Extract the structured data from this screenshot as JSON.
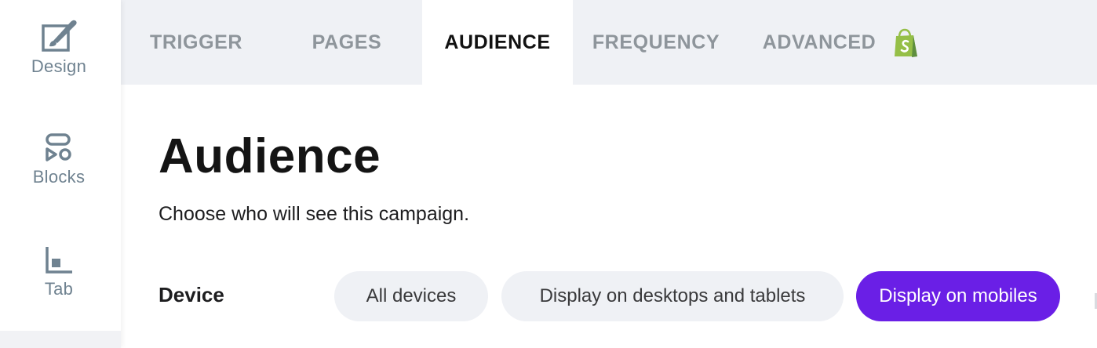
{
  "sidebar": {
    "items": [
      {
        "label": "Design",
        "icon": "design-brush-icon"
      },
      {
        "label": "Blocks",
        "icon": "blocks-icon"
      },
      {
        "label": "Tab",
        "icon": "tab-icon"
      }
    ]
  },
  "tabs": [
    {
      "label": "TRIGGER",
      "active": false
    },
    {
      "label": "PAGES",
      "active": false
    },
    {
      "label": "AUDIENCE",
      "active": true
    },
    {
      "label": "FREQUENCY",
      "active": false
    },
    {
      "label": "ADVANCED",
      "active": false
    }
  ],
  "advanced_badge_icon": "shopify-bag-icon",
  "main": {
    "title": "Audience",
    "subtitle": "Choose who will see this campaign.",
    "device": {
      "label": "Device",
      "options": [
        {
          "label": "All devices",
          "selected": false
        },
        {
          "label": "Display on desktops and tablets",
          "selected": false
        },
        {
          "label": "Display on mobiles",
          "selected": true
        }
      ]
    }
  },
  "colors": {
    "accent": "#6a1fe6",
    "tab_bar": "#eff1f5",
    "sidebar_icon": "#6f8290",
    "shopify_green": "#95bf47"
  }
}
